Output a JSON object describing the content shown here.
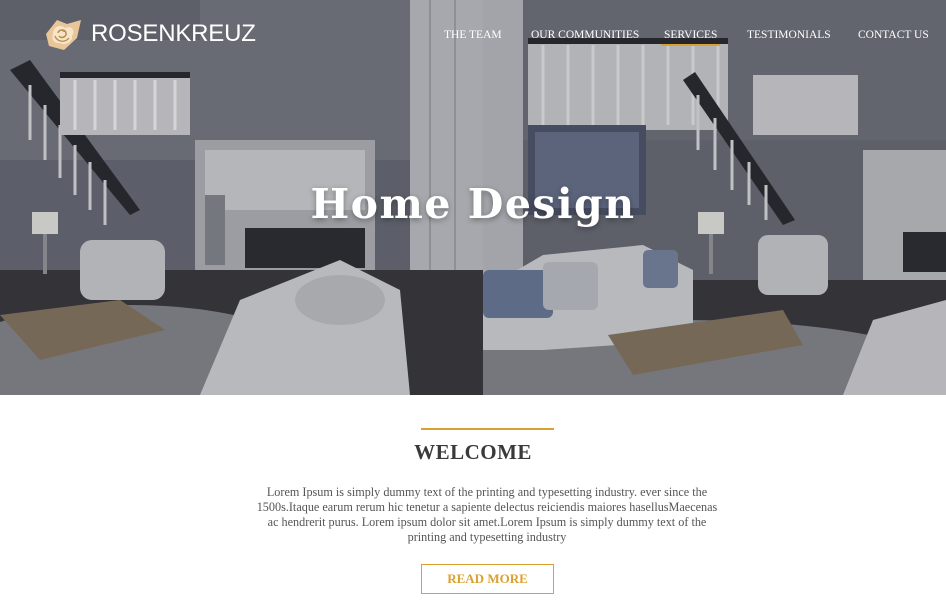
{
  "brand": {
    "name": "ROSENKREUZ",
    "logo_icon": "rose-icon"
  },
  "nav": {
    "items": [
      {
        "label": "THE TEAM",
        "active": false
      },
      {
        "label": "OUR COMMUNITIES",
        "active": false
      },
      {
        "label": "SERVICES",
        "active": true
      },
      {
        "label": "TESTIMONIALS",
        "active": false
      },
      {
        "label": "CONTACT US",
        "active": false
      }
    ]
  },
  "hero": {
    "title": "Home Design"
  },
  "welcome": {
    "title": "WELCOME",
    "body": "Lorem Ipsum is simply dummy text of the printing and typesetting industry. ever since the 1500s.Itaque earum rerum hic tenetur a sapiente delectus reiciendis maiores hasellusMaecenas ac hendrerit purus. Lorem ipsum dolor sit amet.Lorem Ipsum is simply dummy text of the printing and typesetting industry",
    "cta_label": "READ MORE"
  },
  "colors": {
    "accent": "#d9a12f",
    "heading": "#3a3a3a",
    "body_text": "#555555"
  }
}
